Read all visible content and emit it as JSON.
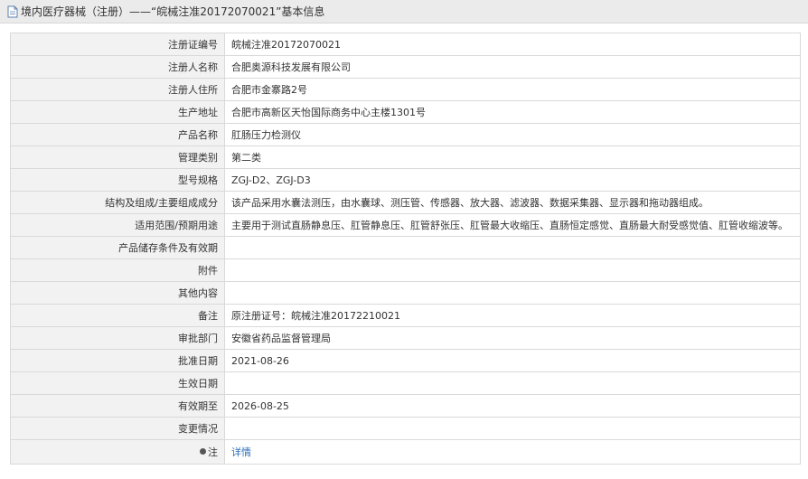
{
  "header": {
    "title": "境内医疗器械（注册）——“皖械注准20172070021”基本信息",
    "icon": "document-icon"
  },
  "rows": [
    {
      "label": "注册证编号",
      "value": "皖械注准20172070021"
    },
    {
      "label": "注册人名称",
      "value": "合肥奥源科技发展有限公司"
    },
    {
      "label": "注册人住所",
      "value": "合肥市金寨路2号"
    },
    {
      "label": "生产地址",
      "value": "合肥市高新区天怡国际商务中心主楼1301号"
    },
    {
      "label": "产品名称",
      "value": "肛肠压力检测仪"
    },
    {
      "label": "管理类别",
      "value": "第二类"
    },
    {
      "label": "型号规格",
      "value": "ZGJ-D2、ZGJ-D3"
    },
    {
      "label": "结构及组成/主要组成成分",
      "value": "该产品采用水囊法测压，由水囊球、测压管、传感器、放大器、滤波器、数据采集器、显示器和拖动器组成。"
    },
    {
      "label": "适用范围/预期用途",
      "value": "主要用于测试直肠静息压、肛管静息压、肛管舒张压、肛管最大收缩压、直肠恒定感觉、直肠最大耐受感觉值、肛管收缩波等。"
    },
    {
      "label": "产品储存条件及有效期",
      "value": ""
    },
    {
      "label": "附件",
      "value": ""
    },
    {
      "label": "其他内容",
      "value": ""
    },
    {
      "label": "备注",
      "value": "原注册证号：皖械注准20172210021"
    },
    {
      "label": "审批部门",
      "value": "安徽省药品监督管理局"
    },
    {
      "label": "批准日期",
      "value": "2021-08-26"
    },
    {
      "label": "生效日期",
      "value": ""
    },
    {
      "label": "有效期至",
      "value": "2026-08-25"
    },
    {
      "label": "变更情况",
      "value": ""
    }
  ],
  "note_row": {
    "label": "注",
    "link_text": "详情"
  }
}
